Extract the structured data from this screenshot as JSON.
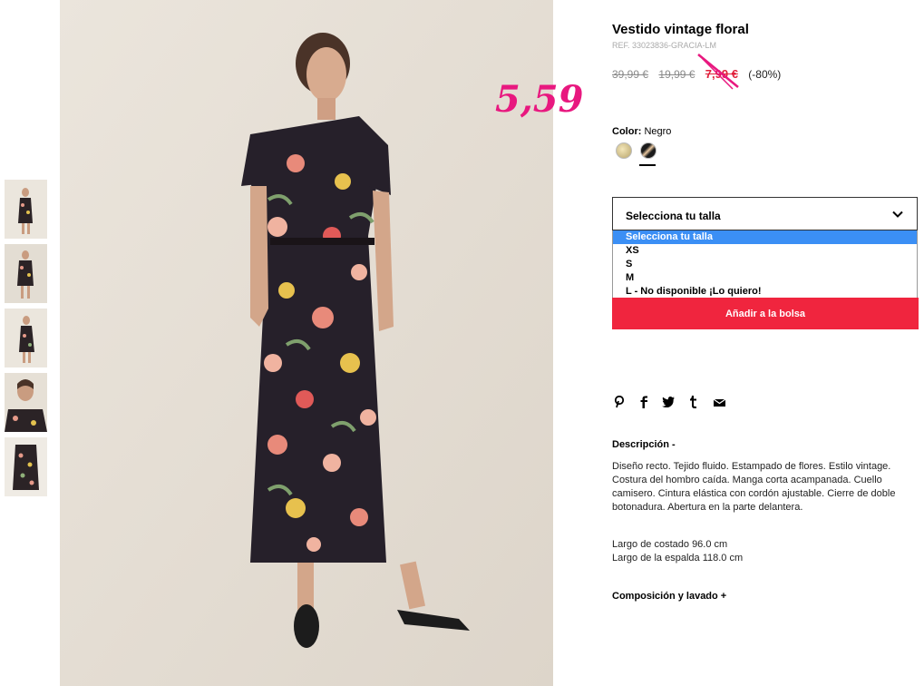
{
  "product": {
    "title": "Vestido vintage floral",
    "ref": "REF. 33023836-GRACIA-LM",
    "prices": {
      "original": "39,99 €",
      "previous": "19,99 €",
      "sale": "7,99 €",
      "discount": "(-80%)"
    },
    "handwritten_price": "5,59",
    "color": {
      "label": "Color:",
      "value": "Negro",
      "swatches": [
        "cream-swatch",
        "black-floral-swatch"
      ]
    },
    "size_select": {
      "label": "Selecciona tu talla",
      "options": [
        "Selecciona tu talla",
        "XS",
        "S",
        "M",
        "L - No disponible ¡Lo quiero!"
      ]
    },
    "add_button": "Añadir a la bolsa",
    "share_icons": [
      "pinterest-icon",
      "facebook-icon",
      "twitter-icon",
      "tumblr-icon",
      "email-icon"
    ],
    "description": {
      "heading": "Descripción -",
      "text": "Diseño recto. Tejido fluido. Estampado de flores. Estilo vintage. Costura del hombro caída. Manga corta acampanada. Cuello camisero. Cintura elástica con cordón ajustable. Cierre de doble botonadura. Abertura en la parte delantera.",
      "measure_1": "Largo de costado 96.0 cm",
      "measure_2": "Largo de la espalda 118.0 cm"
    },
    "composition_heading": "Composición y lavado +"
  },
  "colors": {
    "accent_red": "#f0253e",
    "sale_red": "#e0203b",
    "handwritten_pink": "#e8187f",
    "select_highlight": "#3b8ff5"
  }
}
